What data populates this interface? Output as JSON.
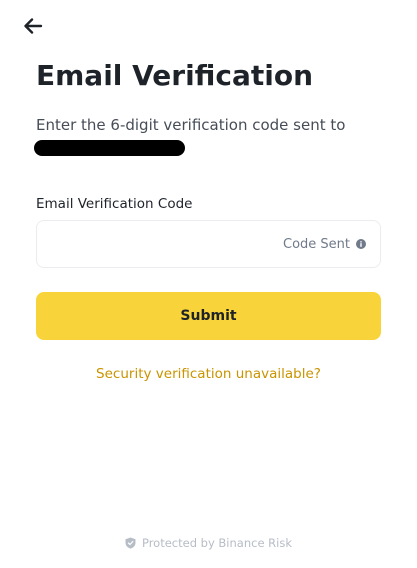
{
  "header": {
    "back_icon": "arrow-left-icon"
  },
  "title": "Email Verification",
  "instruction": "Enter the 6-digit verification code sent to",
  "code_field": {
    "label": "Email Verification Code",
    "value": "",
    "placeholder": "",
    "status_text": "Code Sent",
    "status_icon": "info-icon"
  },
  "submit_label": "Submit",
  "help_link": "Security verification unavailable?",
  "footer": {
    "icon": "shield-icon",
    "text": "Protected by Binance Risk"
  },
  "colors": {
    "primary_button": "#F8D33A",
    "link": "#C99400",
    "text": "#1E2329",
    "muted": "#707A8A",
    "border": "#EAECEF"
  }
}
